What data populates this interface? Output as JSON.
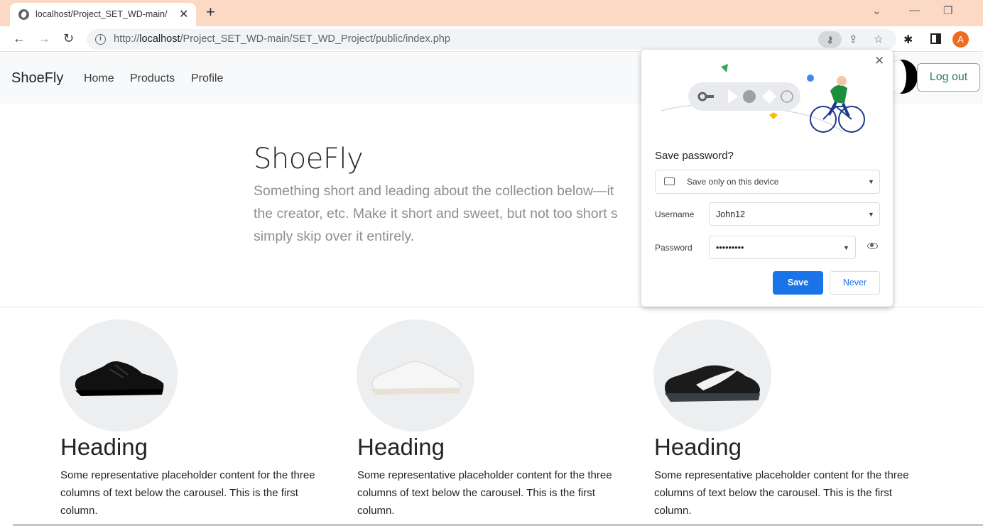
{
  "browser": {
    "tab_title": "localhost/Project_SET_WD-main/",
    "tab_close": "✕",
    "new_tab": "+",
    "url_prefix": "http://",
    "url_host": "localhost",
    "url_path": "/Project_SET_WD-main/SET_WD_Project/public/index.php",
    "profile_initial": "A",
    "icons": [
      "globe-icon",
      "back-arrow-icon",
      "forward-arrow-icon",
      "reload-icon",
      "info-icon",
      "key-icon",
      "share-icon",
      "star-icon",
      "puzzle-icon",
      "side-panel-icon",
      "chevron-down-icon",
      "minimize-icon",
      "restore-icon"
    ]
  },
  "navbar": {
    "brand": "ShoeFly",
    "links": [
      "Home",
      "Products",
      "Profile"
    ],
    "logout_label": "Log out"
  },
  "hero": {
    "title": "ShoeFly",
    "lines": [
      "Something short and leading about the collection below—it",
      "the creator, etc. Make it short and sweet, but not too short s",
      "simply skip over it entirely."
    ]
  },
  "columns": [
    {
      "heading": "Heading",
      "text": "Some representative placeholder content for the three columns of text below the carousel. This is the first column.",
      "shoe": "black"
    },
    {
      "heading": "Heading",
      "text": "Some representative placeholder content for the three columns of text below the carousel. This is the first column.",
      "shoe": "white"
    },
    {
      "heading": "Heading",
      "text": "Some representative placeholder content for the three columns of text below the carousel. This is the first column.",
      "shoe": "trail"
    }
  ],
  "password_popup": {
    "title": "Save password?",
    "storage_option": "Save only on this device",
    "username_label": "Username",
    "username_value": "John12",
    "password_label": "Password",
    "password_value": "•••••••••",
    "save_label": "Save",
    "never_label": "Never",
    "close": "✕"
  },
  "colors": {
    "tabbar": "#fbd9c5",
    "primary": "#1a73e8",
    "logout_green": "#198754",
    "profile": "#f06b22"
  }
}
